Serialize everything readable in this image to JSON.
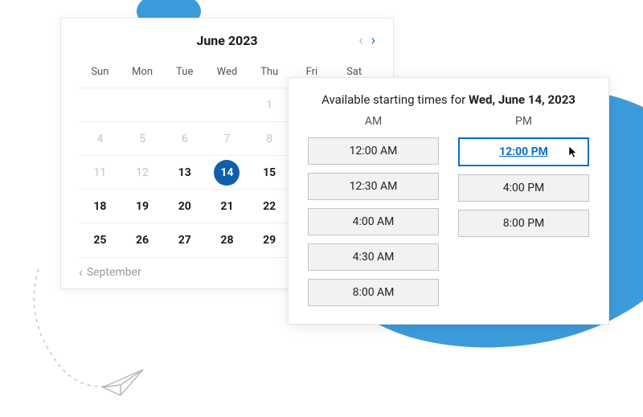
{
  "calendar": {
    "title": "June 2023",
    "dow": [
      "Sun",
      "Mon",
      "Tue",
      "Wed",
      "Thu",
      "Fri",
      "Sat"
    ],
    "weeks": [
      [
        {
          "d": "",
          "dim": true
        },
        {
          "d": "",
          "dim": true
        },
        {
          "d": "",
          "dim": true
        },
        {
          "d": "",
          "dim": true
        },
        {
          "d": "1",
          "dim": true
        },
        {
          "d": "",
          "dim": true
        },
        {
          "d": "",
          "dim": true
        }
      ],
      [
        {
          "d": "4",
          "dim": true
        },
        {
          "d": "5",
          "dim": true
        },
        {
          "d": "6",
          "dim": true
        },
        {
          "d": "7",
          "dim": true
        },
        {
          "d": "8",
          "dim": true
        },
        {
          "d": "",
          "dim": true
        },
        {
          "d": "",
          "dim": true
        }
      ],
      [
        {
          "d": "11",
          "dim": true
        },
        {
          "d": "12",
          "dim": true
        },
        {
          "d": "13",
          "bold": true
        },
        {
          "d": "14",
          "selected": true
        },
        {
          "d": "15",
          "bold": true
        },
        {
          "d": "",
          "dim": true
        },
        {
          "d": "",
          "dim": true
        }
      ],
      [
        {
          "d": "18",
          "bold": true
        },
        {
          "d": "19",
          "bold": true
        },
        {
          "d": "20",
          "bold": true
        },
        {
          "d": "21",
          "bold": true
        },
        {
          "d": "22",
          "bold": true
        },
        {
          "d": "",
          "dim": true
        },
        {
          "d": "",
          "dim": true
        }
      ],
      [
        {
          "d": "25",
          "bold": true
        },
        {
          "d": "26",
          "bold": true
        },
        {
          "d": "27",
          "bold": true
        },
        {
          "d": "28",
          "bold": true
        },
        {
          "d": "29",
          "bold": true
        },
        {
          "d": "",
          "dim": true
        },
        {
          "d": "",
          "dim": true
        }
      ]
    ],
    "footer": {
      "label": "September"
    }
  },
  "times": {
    "heading_prefix": "Available starting times for ",
    "heading_date": "Wed, June 14, 2023",
    "am_label": "AM",
    "pm_label": "PM",
    "am_slots": [
      "12:00 AM",
      "12:30 AM",
      "4:00 AM",
      "4:30 AM",
      "8:00 AM"
    ],
    "pm_slots": [
      "12:00 PM",
      "4:00 PM",
      "8:00 PM"
    ],
    "selected": "12:00 PM"
  }
}
